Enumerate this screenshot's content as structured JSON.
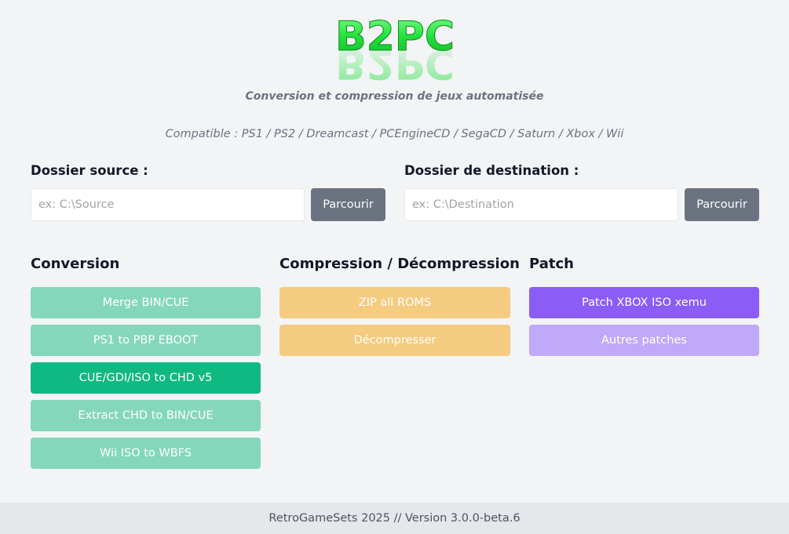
{
  "logo": {
    "text": "B2PC"
  },
  "header": {
    "subtitle": "Conversion et compression de jeux automatisée",
    "compatible": "Compatible : PS1 / PS2 / Dreamcast / PCEngineCD / SegaCD / Saturn / Xbox / Wii"
  },
  "source": {
    "label": "Dossier source :",
    "placeholder": "ex: C:\\Source",
    "value": "",
    "browse_label": "Parcourir"
  },
  "destination": {
    "label": "Dossier de destination :",
    "placeholder": "ex: C:\\Destination",
    "value": "",
    "browse_label": "Parcourir"
  },
  "conversion": {
    "title": "Conversion",
    "buttons": [
      "Merge BIN/CUE",
      "PS1 to PBP EBOOT",
      "CUE/GDI/ISO to CHD v5",
      "Extract CHD to BIN/CUE",
      "Wii ISO to WBFS"
    ]
  },
  "compression": {
    "title": "Compression / Décompression",
    "buttons": [
      "ZIP all ROMS",
      "Décompresser"
    ]
  },
  "patch": {
    "title": "Patch",
    "buttons": [
      "Patch XBOX ISO xemu",
      "Autres patches"
    ]
  },
  "footer": {
    "text": "RetroGameSets 2025 // Version 3.0.0-beta.6"
  },
  "colors": {
    "conversion_light": "#84d7bb",
    "conversion_active": "#10b981",
    "compression": "#f5cb80",
    "patch_primary": "#8b5cf6",
    "patch_secondary": "#c0a9f8",
    "browse": "#6b7280",
    "logo_green": "#22e03a"
  }
}
